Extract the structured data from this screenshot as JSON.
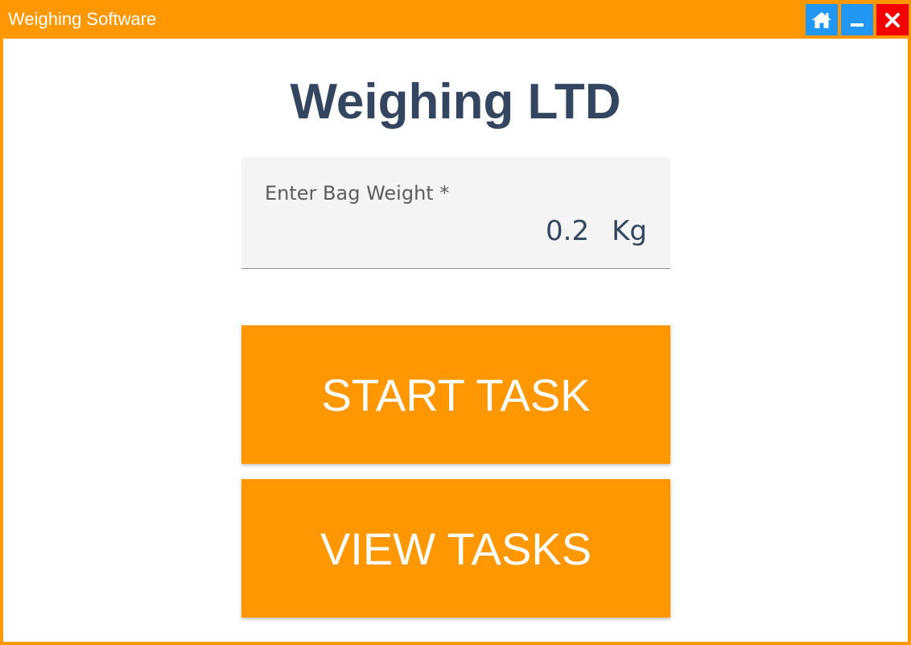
{
  "window": {
    "title": "Weighing Software",
    "controls": {
      "home_icon": "home-icon",
      "minimize_icon": "minimize-icon",
      "close_icon": "close-icon"
    }
  },
  "main": {
    "heading": "Weighing LTD",
    "bag_weight": {
      "label": "Enter Bag Weight *",
      "value": "0.2",
      "unit": "Kg"
    },
    "buttons": {
      "start_task": "START TASK",
      "view_tasks": "VIEW TASKS"
    }
  },
  "colors": {
    "accent": "#ff9800",
    "control_blue": "#2196f3",
    "close_red": "#f50000",
    "heading": "#34465f"
  }
}
